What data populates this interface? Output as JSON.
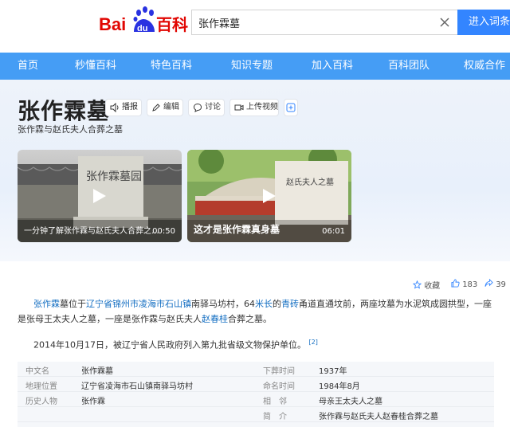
{
  "header": {
    "logo_text_bai": "Bai",
    "logo_text_du": "du",
    "logo_text_baike": "百科",
    "search_value": "张作霖墓",
    "enter_button": "进入词条"
  },
  "nav": {
    "items": [
      "首页",
      "秒懂百科",
      "特色百科",
      "知识专题",
      "加入百科",
      "百科团队",
      "权威合作"
    ]
  },
  "lemma": {
    "title": "张作霖墓",
    "subtitle": "张作霖与赵氏夫人合葬之墓",
    "tools": {
      "play": "播报",
      "edit": "编辑",
      "discuss": "讨论",
      "upload_video": "上传视频"
    }
  },
  "videos": [
    {
      "caption": "一分钟了解张作霖与赵氏夫人合葬之...",
      "duration": "00:50",
      "image_text": "张作霖墓园"
    },
    {
      "caption": "这才是张作霖真身墓",
      "duration": "06:01",
      "image_text": "赵氏夫人之墓"
    }
  ],
  "actions": {
    "collect": "收藏",
    "likes": "183",
    "shares": "39"
  },
  "summary": {
    "p1": {
      "a": "张作霖",
      "b": "墓位于",
      "c": "辽宁省锦州市凌海市石山镇",
      "d": "南驿马坊村，64",
      "e": "米长",
      "f": "的",
      "g": "青砖",
      "h": "甬道直通坟前，两座坟墓为水泥筑成圆拱型，一座是张",
      "i": "母王太夫人之墓，一座是张作霖与赵氏夫人",
      "j": "赵春桂",
      "k": "合葬之墓。"
    },
    "p2": "2014年10月17日，被辽宁省人民政府列入第九批省级文物保护单位。",
    "p2_ref": "[2]"
  },
  "info": {
    "left": [
      {
        "k": "中文名",
        "v": "张作霖墓"
      },
      {
        "k": "地理位置",
        "v": "辽宁省凌海市石山镇南驿马坊村"
      },
      {
        "k": "历史人物",
        "v": "张作霖"
      }
    ],
    "right": [
      {
        "k": "下葬时间",
        "v": "1937年"
      },
      {
        "k": "命名时间",
        "v": "1984年8月"
      },
      {
        "k": "相　邻",
        "v": "母亲王太夫人之墓"
      },
      {
        "k": "简　介",
        "v": "张作霖与赵氏夫人赵春桂合葬之墓"
      }
    ]
  },
  "colors": {
    "brand_blue": "#3385ff",
    "nav_blue": "#459df5",
    "logo_red": "#e10602",
    "link_blue": "#136ec2"
  }
}
